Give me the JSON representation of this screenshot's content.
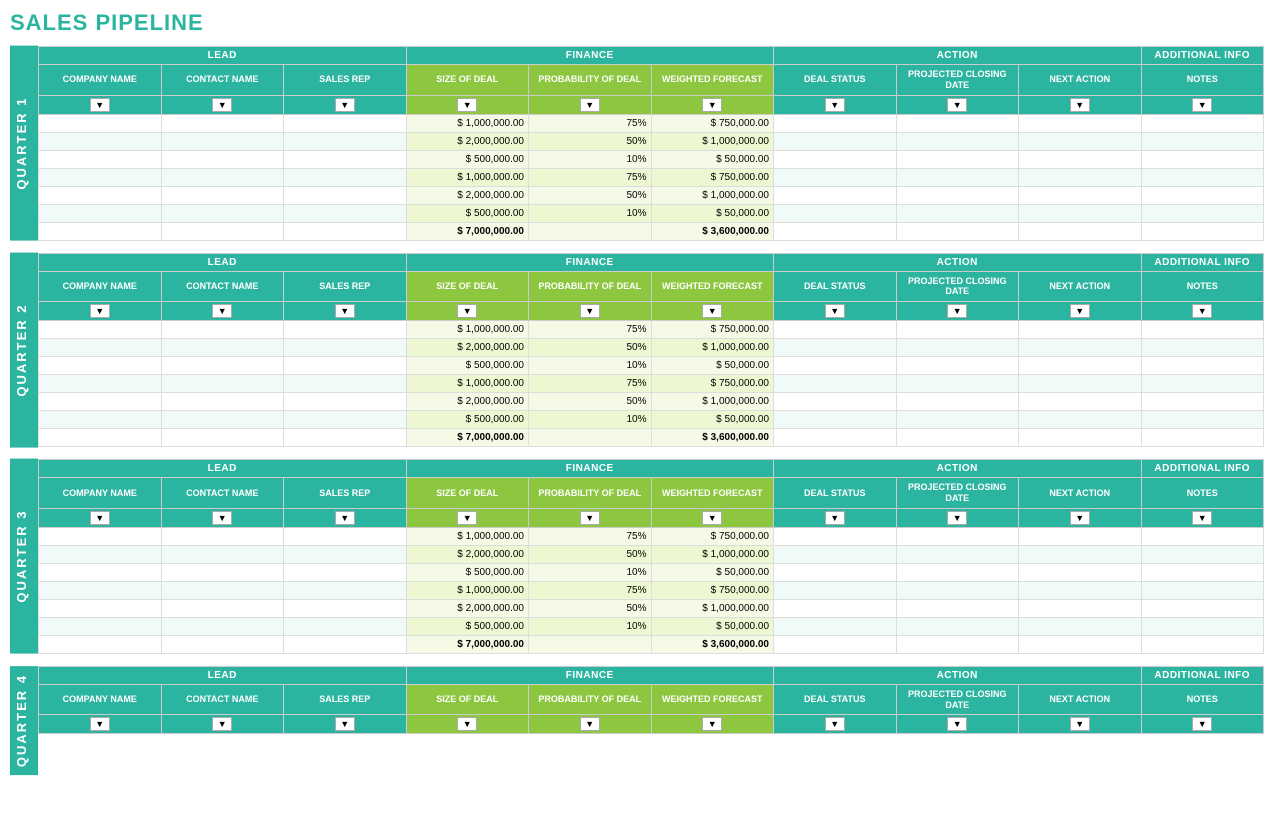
{
  "title": "SALES PIPELINE",
  "sections": {
    "lead": "LEAD",
    "finance": "FINANCE",
    "action": "ACTION",
    "additional": "ADDITIONAL INFO"
  },
  "columns": {
    "company": "COMPANY NAME",
    "contact": "CONTACT NAME",
    "salesrep": "SALES REP",
    "sizedeal": "SIZE OF DEAL",
    "probability": "PROBABILITY OF DEAL",
    "weighted": "WEIGHTED FORECAST",
    "dealstatus": "DEAL STATUS",
    "closing": "PROJECTED CLOSING DATE",
    "nextaction": "NEXT ACTION",
    "notes": "NOTES"
  },
  "quarters": [
    {
      "label": "QUARTER 1",
      "rows": [
        {
          "size": "$ 1,000,000.00",
          "prob": "75%",
          "weighted": "$ 750,000.00"
        },
        {
          "size": "$ 2,000,000.00",
          "prob": "50%",
          "weighted": "$ 1,000,000.00"
        },
        {
          "size": "$ 500,000.00",
          "prob": "10%",
          "weighted": "$ 50,000.00"
        },
        {
          "size": "$ 1,000,000.00",
          "prob": "75%",
          "weighted": "$ 750,000.00"
        },
        {
          "size": "$ 2,000,000.00",
          "prob": "50%",
          "weighted": "$ 1,000,000.00"
        },
        {
          "size": "$ 500,000.00",
          "prob": "10%",
          "weighted": "$ 50,000.00"
        }
      ],
      "total_size": "$ 7,000,000.00",
      "total_weighted": "$ 3,600,000.00"
    },
    {
      "label": "QUARTER 2",
      "rows": [
        {
          "size": "$ 1,000,000.00",
          "prob": "75%",
          "weighted": "$ 750,000.00"
        },
        {
          "size": "$ 2,000,000.00",
          "prob": "50%",
          "weighted": "$ 1,000,000.00"
        },
        {
          "size": "$ 500,000.00",
          "prob": "10%",
          "weighted": "$ 50,000.00"
        },
        {
          "size": "$ 1,000,000.00",
          "prob": "75%",
          "weighted": "$ 750,000.00"
        },
        {
          "size": "$ 2,000,000.00",
          "prob": "50%",
          "weighted": "$ 1,000,000.00"
        },
        {
          "size": "$ 500,000.00",
          "prob": "10%",
          "weighted": "$ 50,000.00"
        }
      ],
      "total_size": "$ 7,000,000.00",
      "total_weighted": "$ 3,600,000.00"
    },
    {
      "label": "QUARTER 3",
      "rows": [
        {
          "size": "$ 1,000,000.00",
          "prob": "75%",
          "weighted": "$ 750,000.00"
        },
        {
          "size": "$ 2,000,000.00",
          "prob": "50%",
          "weighted": "$ 1,000,000.00"
        },
        {
          "size": "$ 500,000.00",
          "prob": "10%",
          "weighted": "$ 50,000.00"
        },
        {
          "size": "$ 1,000,000.00",
          "prob": "75%",
          "weighted": "$ 750,000.00"
        },
        {
          "size": "$ 2,000,000.00",
          "prob": "50%",
          "weighted": "$ 1,000,000.00"
        },
        {
          "size": "$ 500,000.00",
          "prob": "10%",
          "weighted": "$ 50,000.00"
        }
      ],
      "total_size": "$ 7,000,000.00",
      "total_weighted": "$ 3,600,000.00"
    },
    {
      "label": "QUARTER 4",
      "rows": [],
      "total_size": "",
      "total_weighted": ""
    }
  ]
}
